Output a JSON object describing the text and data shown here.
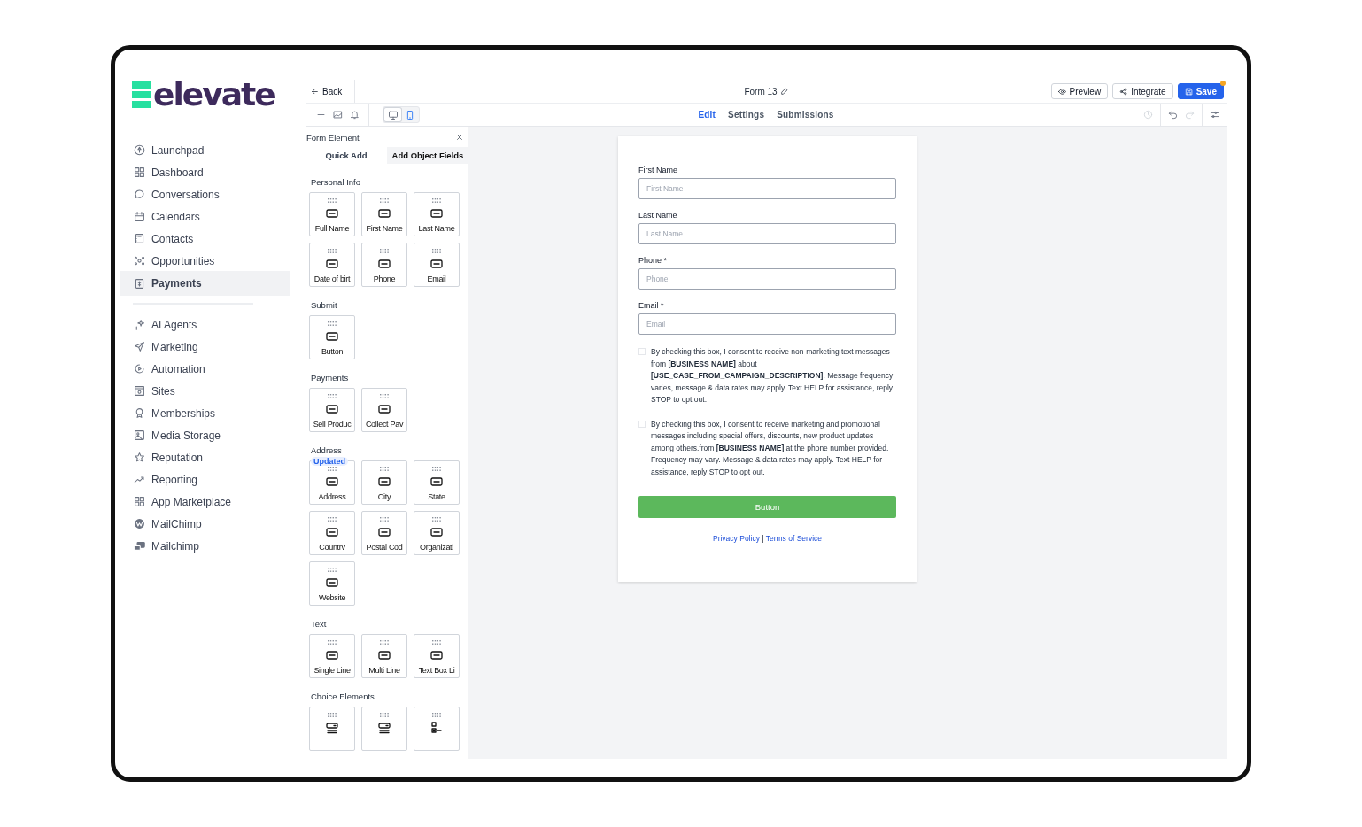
{
  "logo": {
    "text": "elevate"
  },
  "sidebar": {
    "groups": [
      {
        "items": [
          {
            "label": "Launchpad",
            "selected": false
          },
          {
            "label": "Dashboard",
            "selected": false
          },
          {
            "label": "Conversations",
            "selected": false
          },
          {
            "label": "Calendars",
            "selected": false
          },
          {
            "label": "Contacts",
            "selected": false
          },
          {
            "label": "Opportunities",
            "selected": false
          },
          {
            "label": "Payments",
            "selected": true
          }
        ]
      },
      {
        "items": [
          {
            "label": "AI Agents",
            "selected": false
          },
          {
            "label": "Marketing",
            "selected": false
          },
          {
            "label": "Automation",
            "selected": false
          },
          {
            "label": "Sites",
            "selected": false
          },
          {
            "label": "Memberships",
            "selected": false
          },
          {
            "label": "Media Storage",
            "selected": false
          },
          {
            "label": "Reputation",
            "selected": false
          },
          {
            "label": "Reporting",
            "selected": false
          },
          {
            "label": "App Marketplace",
            "selected": false
          },
          {
            "label": "MailChimp",
            "selected": false
          },
          {
            "label": "Mailchimp",
            "selected": false
          }
        ]
      }
    ]
  },
  "editor": {
    "back": "Back",
    "form_title": "Form 13",
    "preview": "Preview",
    "integrate": "Integrate",
    "save": "Save",
    "unsaved_changes": true,
    "device_modes": [
      {
        "kind": "desktop",
        "selected": true
      },
      {
        "kind": "mobile",
        "selected": false
      }
    ],
    "tabs": [
      {
        "label": "Edit",
        "selected": true
      },
      {
        "label": "Settings",
        "selected": false
      },
      {
        "label": "Submissions",
        "selected": false
      }
    ]
  },
  "panel": {
    "title": "Form Element",
    "tabs": [
      {
        "label": "Quick Add",
        "selected": false
      },
      {
        "label": "Add Object Fields",
        "selected": true
      }
    ],
    "sections": [
      {
        "title": "Personal Info",
        "items": [
          {
            "label": "Full Name"
          },
          {
            "label": "First Name"
          },
          {
            "label": "Last Name"
          },
          {
            "label": "Date of birt"
          },
          {
            "label": "Phone"
          },
          {
            "label": "Email"
          }
        ]
      },
      {
        "title": "Submit",
        "items": [
          {
            "label": "Button"
          }
        ]
      },
      {
        "title": "Payments",
        "items": [
          {
            "label": "Sell Produc"
          },
          {
            "label": "Collect Pav"
          }
        ]
      },
      {
        "title": "Address",
        "items": [
          {
            "label": "Address",
            "badge": "Updated"
          },
          {
            "label": "City"
          },
          {
            "label": "State"
          },
          {
            "label": "Countrv"
          },
          {
            "label": "Postal Cod"
          },
          {
            "label": "Organizati"
          },
          {
            "label": "Website"
          }
        ]
      },
      {
        "title": "Text",
        "items": [
          {
            "label": "Single Line"
          },
          {
            "label": "Multi Line"
          },
          {
            "label": "Text Box Li"
          }
        ]
      },
      {
        "title": "Choice Elements",
        "items": [
          {
            "kind": "dropdown"
          },
          {
            "kind": "dropdown"
          },
          {
            "kind": "checkbox_list"
          }
        ]
      }
    ]
  },
  "form": {
    "fields": [
      {
        "label": "First Name",
        "placeholder": "First Name"
      },
      {
        "label": "Last Name",
        "placeholder": "Last Name"
      },
      {
        "label": "Phone *",
        "placeholder": "Phone"
      },
      {
        "label": "Email *",
        "placeholder": "Email"
      }
    ],
    "consents": [
      {
        "checked": false,
        "text": "By checking this box, I consent to receive non-marketing text messages from **[BUSINESS NAME]** about **[USE_CASE_FROM_CAMPAIGN_DESCRIPTION]**. Message frequency varies, message & data rates may apply. Text HELP for assistance, reply STOP to opt out."
      },
      {
        "checked": false,
        "text": "By checking this box, I consent to receive marketing and promotional messages including special offers, discounts, new product updates among others.from **[BUSINESS NAME]** at the phone number provided. Frequency may vary. Message & data rates may apply. Text HELP for assistance, reply STOP to opt out."
      }
    ],
    "button": "Button",
    "links": [
      {
        "label": "Privacy Policy"
      },
      {
        "label": "Terms of Service"
      }
    ],
    "link_separator": "|"
  }
}
